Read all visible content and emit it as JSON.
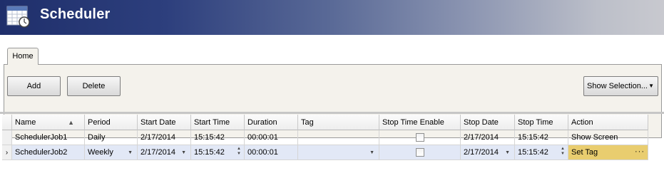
{
  "app": {
    "title": "Scheduler",
    "icon": "calendar-clock-icon"
  },
  "ribbon": {
    "tabs": [
      {
        "label": "Home",
        "selected": true
      }
    ],
    "buttons": {
      "add": "Add",
      "delete": "Delete",
      "show_selection": "Show Selection..."
    }
  },
  "grid": {
    "columns": [
      "Name",
      "Period",
      "Start Date",
      "Start Time",
      "Duration",
      "Tag",
      "Stop Time Enable",
      "Stop Date",
      "Stop Time",
      "Action"
    ],
    "sorted_column": "Name",
    "sort_direction": "ascending",
    "rows": [
      {
        "name": "SchedulerJob1",
        "period": "Daily",
        "start_date": "2/17/2014",
        "start_time": "15:15:42",
        "duration": "00:00:01",
        "tag": "",
        "stop_time_enable": false,
        "stop_date": "2/17/2014",
        "stop_time": "15:15:42",
        "action": "Show Screen",
        "selected": false
      },
      {
        "name": "SchedulerJob2",
        "period": "Weekly",
        "start_date": "2/17/2014",
        "start_time": "15:15:42",
        "duration": "00:00:01",
        "tag": "",
        "stop_time_enable": false,
        "stop_date": "2/17/2014",
        "stop_time": "15:15:42",
        "action": "Set Tag",
        "selected": true
      }
    ]
  },
  "colors": {
    "title_gradient_start": "#1f2f6b",
    "selected_row": "#e2e8f6",
    "active_cell": "#e9cd6f"
  }
}
